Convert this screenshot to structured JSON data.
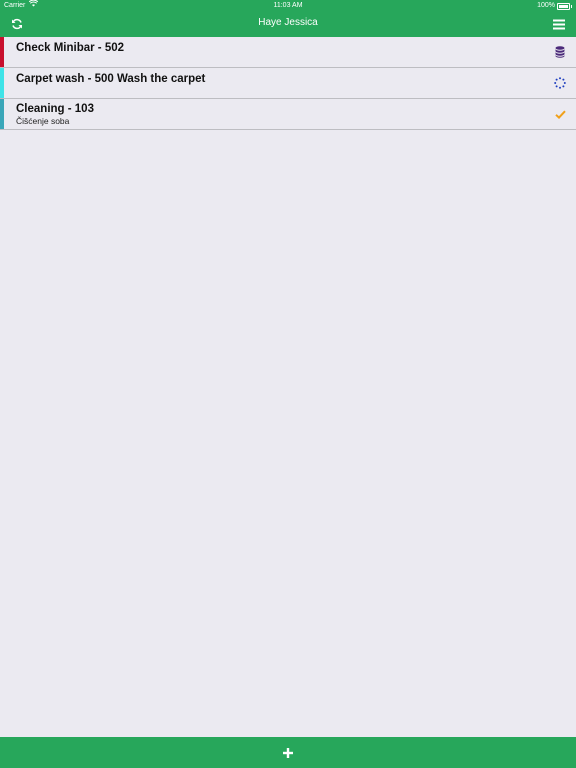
{
  "status_bar": {
    "carrier": "Carrier",
    "time": "11:03 AM",
    "battery": "100%"
  },
  "header": {
    "title": "Haye Jessica",
    "left_icon": "refresh-icon",
    "right_icon": "hamburger-menu-icon"
  },
  "tasks": [
    {
      "title": "Check Minibar - 502",
      "subtitle": "",
      "color": "#c8102e",
      "status_icon": "database-icon",
      "status_color": "#4b2a7a"
    },
    {
      "title": "Carpet wash - 500 Wash the carpet",
      "subtitle": "",
      "color": "#3fe3e8",
      "status_icon": "spinner-icon",
      "status_color": "#1f3fbf"
    },
    {
      "title": "Cleaning - 103",
      "subtitle": "Čišćenje soba",
      "color": "#3aa6b9",
      "status_icon": "checkmark-icon",
      "status_color": "#f0a01a"
    }
  ],
  "footer": {
    "add_icon": "plus-icon"
  },
  "colors": {
    "accent": "#27a75b",
    "background": "#ebeaf1"
  }
}
